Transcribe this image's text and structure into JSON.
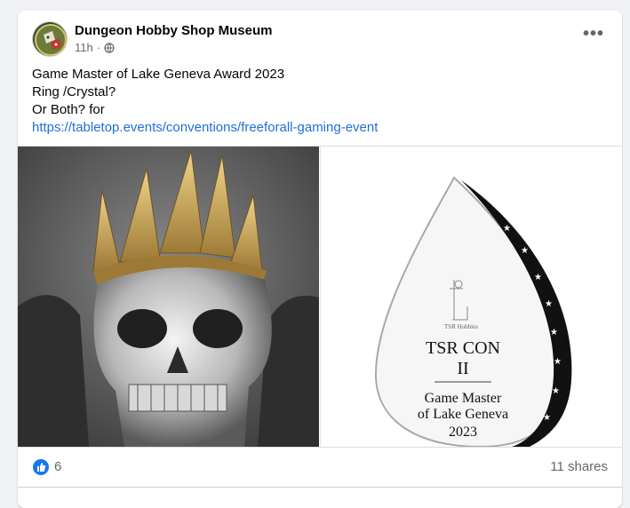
{
  "post": {
    "page_name": "Dungeon Hobby Shop Museum",
    "time": "11h",
    "separator": "·",
    "privacy_icon": "globe-icon",
    "more_label": "•••",
    "lines": [
      "Game Master of Lake Geneva Award 2023",
      "Ring /Crystal?",
      "Or Both? for"
    ],
    "link": "https://tabletop.events/conventions/freeforall-gaming-event"
  },
  "media": {
    "left_image": "skull-crown-ring-photo",
    "right_image": "crystal-flame-award",
    "award": {
      "brand": "TSR Hobbies",
      "line1": "TSR CON",
      "line2": "II",
      "line3": "Game Master",
      "line4": "of Lake Geneva",
      "line5": "2023"
    }
  },
  "stats": {
    "reaction_icon": "like-reaction-icon",
    "reactions_count": "6",
    "shares": "11 shares"
  },
  "colors": {
    "accent": "#1877f2",
    "link": "#216fdb",
    "muted": "#65676b"
  }
}
